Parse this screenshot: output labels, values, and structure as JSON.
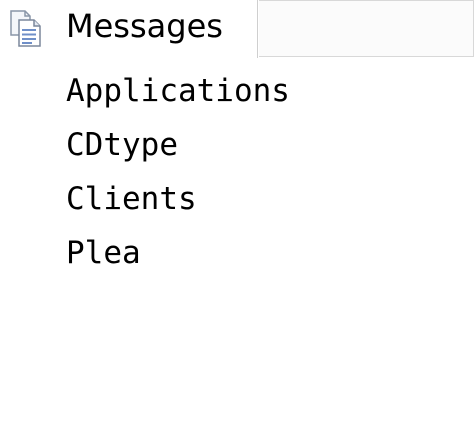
{
  "tabs": {
    "messages_label": "Messages",
    "messages_icon": "document-with-lines-icon"
  },
  "messages": {
    "lines": [
      "Applications",
      "CDtype",
      "Clients",
      "Plea"
    ]
  }
}
